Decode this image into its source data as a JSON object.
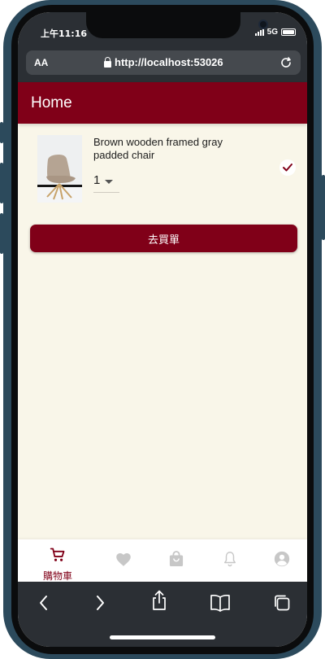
{
  "status_bar": {
    "time": "上午11:16",
    "network": "5G"
  },
  "browser": {
    "text_size_label": "AA",
    "url": "http://localhost:53026"
  },
  "app_bar": {
    "title": "Home"
  },
  "cart": {
    "items": [
      {
        "name": "Brown wooden framed gray padded chair",
        "quantity": "1",
        "selected": true
      }
    ],
    "checkout_label": "去買單"
  },
  "bottom_nav": {
    "items": [
      {
        "icon": "cart-icon",
        "label": "購物車",
        "active": true
      },
      {
        "icon": "heart-icon",
        "label": "",
        "active": false
      },
      {
        "icon": "shopping-bag-icon",
        "label": "",
        "active": false
      },
      {
        "icon": "bell-icon",
        "label": "",
        "active": false
      },
      {
        "icon": "account-icon",
        "label": "",
        "active": false
      }
    ]
  },
  "safari_toolbar": {
    "items": [
      "back-icon",
      "forward-icon",
      "share-icon",
      "bookmarks-icon",
      "tabs-icon"
    ]
  },
  "colors": {
    "brand": "#800018",
    "background": "#f9f6e9",
    "inactive_icon": "#c7c7c7",
    "browser_chrome": "#2b2f34"
  }
}
